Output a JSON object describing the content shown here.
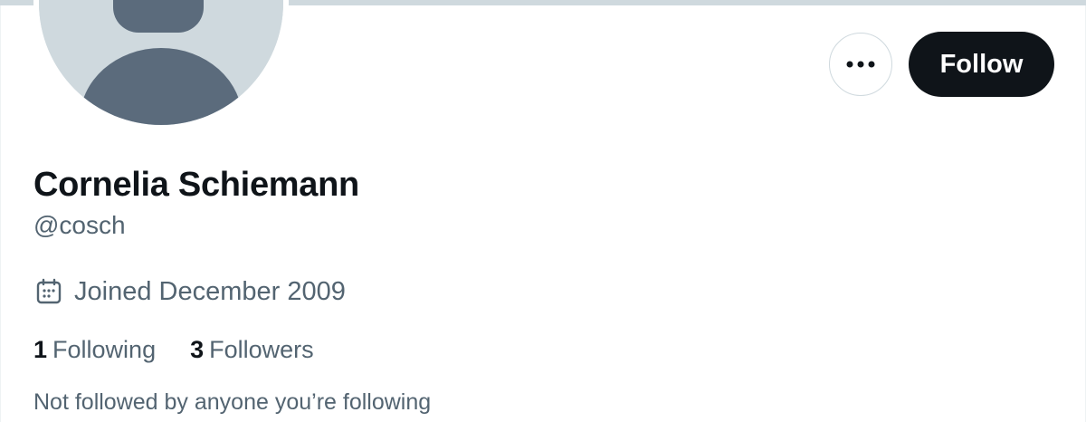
{
  "profile": {
    "display_name": "Cornelia Schiemann",
    "handle": "@cosch",
    "joined": "Joined December 2009",
    "following_count": "1",
    "following_label": "Following",
    "followers_count": "3",
    "followers_label": "Followers",
    "not_followed_text": "Not followed by anyone you’re following"
  },
  "actions": {
    "more_icon": "more-horizontal-icon",
    "follow_label": "Follow"
  },
  "icons": {
    "calendar": "calendar-icon",
    "avatar": "default-avatar-icon"
  },
  "colors": {
    "primary_text": "#0f1419",
    "secondary_text": "#536471",
    "follow_bg": "#0f1419",
    "border": "#cfd9de",
    "avatar_bg": "#cfd9de",
    "avatar_fg": "#5b6b7c"
  }
}
